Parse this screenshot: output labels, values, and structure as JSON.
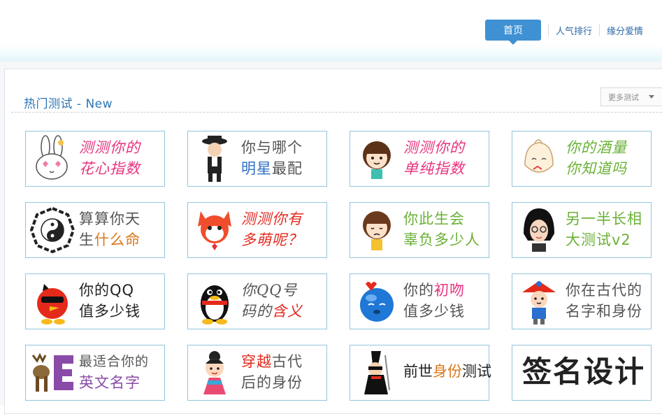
{
  "nav": {
    "home": "首页",
    "ranking": "人气排行",
    "love": "缘分爱情"
  },
  "section": {
    "title": "热门测试 - New",
    "more": "更多测试"
  },
  "cards": [
    {
      "line1": "测测你的",
      "line2": "花心指数",
      "icon": "bunny-icon"
    },
    {
      "line1": "你与哪个",
      "line2a": "明星",
      "line2b": "最配",
      "icon": "michael-jackson-icon"
    },
    {
      "line1": "测测你的",
      "line2": "单纯指数",
      "icon": "girl-icon"
    },
    {
      "line1": "你的酒量",
      "line2": "你知道吗",
      "icon": "bun-mascot-icon"
    },
    {
      "line1": "算算你天",
      "line2a": "生",
      "line2b": "什么命",
      "icon": "yin-yang-icon"
    },
    {
      "line1": "测测你有",
      "line2": "多萌呢？",
      "icon": "fox-icon"
    },
    {
      "line1": "你此生会",
      "line2": "辜负多少人",
      "icon": "crying-girl-icon"
    },
    {
      "line1": "另一半长相",
      "line2": "大测试v2",
      "icon": "glasses-lady-icon"
    },
    {
      "line1": "你的QQ",
      "line2": "值多少钱",
      "icon": "red-bird-icon"
    },
    {
      "line1": "你QQ号",
      "line2a": "码的",
      "line2b": "含义",
      "icon": "qq-penguin-icon"
    },
    {
      "line1a": "你的",
      "line1b": "初吻",
      "line2": "值多少钱",
      "icon": "blue-ball-icon"
    },
    {
      "line1": "你在古代的",
      "line2": "名字和身份",
      "icon": "ancient-boy-icon"
    },
    {
      "line1": "最适合你的",
      "line2": "英文名字",
      "icon": "moose-letter-e-icon"
    },
    {
      "line1a": "穿越",
      "line1b": "古代",
      "line2": "后的身份",
      "icon": "ancient-girl-icon"
    },
    {
      "line1a": "前世",
      "line1b": "身份",
      "line1c": "测试",
      "icon": "ninja-icon"
    },
    {
      "line1": "签名设计",
      "icon": "signature-icon"
    }
  ]
}
